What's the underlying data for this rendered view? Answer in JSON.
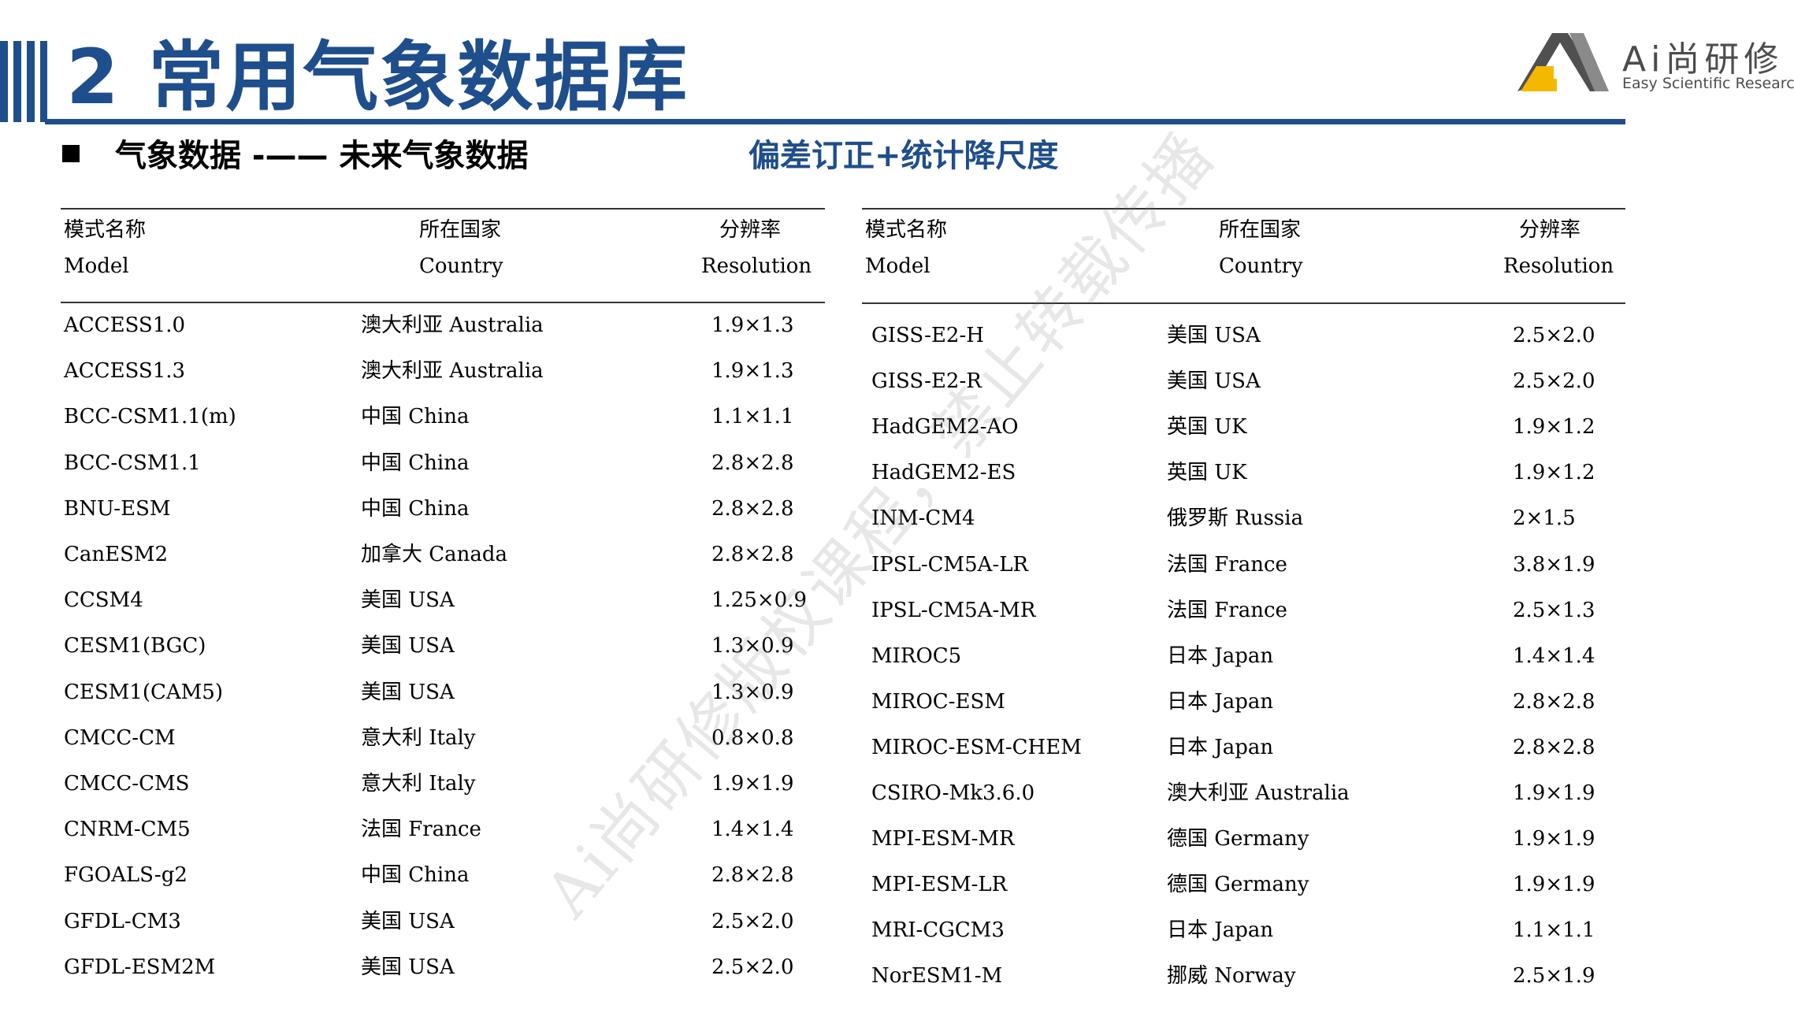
{
  "header": {
    "title": "2 常用气象数据库",
    "subtitle": "气象数据 -—— 未来气象数据",
    "note": "偏差订正+统计降尺度",
    "logo_text": "Ai尚研修",
    "logo_sub": "Easy Scientific Research",
    "accent_color": "#1f4e8c"
  },
  "watermark": "Ai尚研修版权课程，禁止转载传播",
  "columns": {
    "model_cn": "模式名称",
    "model_en": "Model",
    "country_cn": "所在国家",
    "country_en": "Country",
    "res_cn": "分辨率",
    "res_en": "Resolution"
  },
  "left_rows": [
    {
      "model": "ACCESS1.0",
      "country": "澳大利亚  Australia",
      "res": "1.9×1.3"
    },
    {
      "model": "ACCESS1.3",
      "country": "澳大利亚  Australia",
      "res": "1.9×1.3"
    },
    {
      "model": "BCC-CSM1.1(m)",
      "country": "中国  China",
      "res": "1.1×1.1"
    },
    {
      "model": "BCC-CSM1.1",
      "country": "中国  China",
      "res": "2.8×2.8"
    },
    {
      "model": "BNU-ESM",
      "country": "中国  China",
      "res": "2.8×2.8"
    },
    {
      "model": "CanESM2",
      "country": "加拿大  Canada",
      "res": "2.8×2.8"
    },
    {
      "model": "CCSM4",
      "country": "美国  USA",
      "res": "1.25×0.9"
    },
    {
      "model": "CESM1(BGC)",
      "country": "美国  USA",
      "res": "1.3×0.9"
    },
    {
      "model": "CESM1(CAM5)",
      "country": "美国  USA",
      "res": "1.3×0.9"
    },
    {
      "model": "CMCC-CM",
      "country": "意大利  Italy",
      "res": "0.8×0.8"
    },
    {
      "model": "CMCC-CMS",
      "country": "意大利  Italy",
      "res": "1.9×1.9"
    },
    {
      "model": "CNRM-CM5",
      "country": "法国  France",
      "res": "1.4×1.4"
    },
    {
      "model": "FGOALS-g2",
      "country": "中国  China",
      "res": "2.8×2.8"
    },
    {
      "model": "GFDL-CM3",
      "country": "美国  USA",
      "res": "2.5×2.0"
    },
    {
      "model": "GFDL-ESM2M",
      "country": "美国  USA",
      "res": "2.5×2.0"
    }
  ],
  "right_rows": [
    {
      "model": "GISS-E2-H",
      "country": "美国  USA",
      "res": "2.5×2.0"
    },
    {
      "model": "GISS-E2-R",
      "country": "美国  USA",
      "res": "2.5×2.0"
    },
    {
      "model": "HadGEM2-AO",
      "country": "英国  UK",
      "res": "1.9×1.2"
    },
    {
      "model": "HadGEM2-ES",
      "country": "英国  UK",
      "res": "1.9×1.2"
    },
    {
      "model": "INM-CM4",
      "country": "俄罗斯  Russia",
      "res": "2×1.5"
    },
    {
      "model": "IPSL-CM5A-LR",
      "country": "法国  France",
      "res": "3.8×1.9"
    },
    {
      "model": "IPSL-CM5A-MR",
      "country": "法国  France",
      "res": "2.5×1.3"
    },
    {
      "model": "MIROC5",
      "country": "日本  Japan",
      "res": "1.4×1.4"
    },
    {
      "model": "MIROC-ESM",
      "country": "日本  Japan",
      "res": "2.8×2.8"
    },
    {
      "model": "MIROC-ESM-CHEM",
      "country": "日本  Japan",
      "res": "2.8×2.8"
    },
    {
      "model": "CSIRO-Mk3.6.0",
      "country": "澳大利亚  Australia",
      "res": "1.9×1.9"
    },
    {
      "model": "MPI-ESM-MR",
      "country": "德国  Germany",
      "res": "1.9×1.9"
    },
    {
      "model": "MPI-ESM-LR",
      "country": "德国  Germany",
      "res": "1.9×1.9"
    },
    {
      "model": "MRI-CGCM3",
      "country": "日本  Japan",
      "res": "1.1×1.1"
    },
    {
      "model": "NorESM1-M",
      "country": "挪威  Norway",
      "res": "2.5×1.9"
    }
  ]
}
